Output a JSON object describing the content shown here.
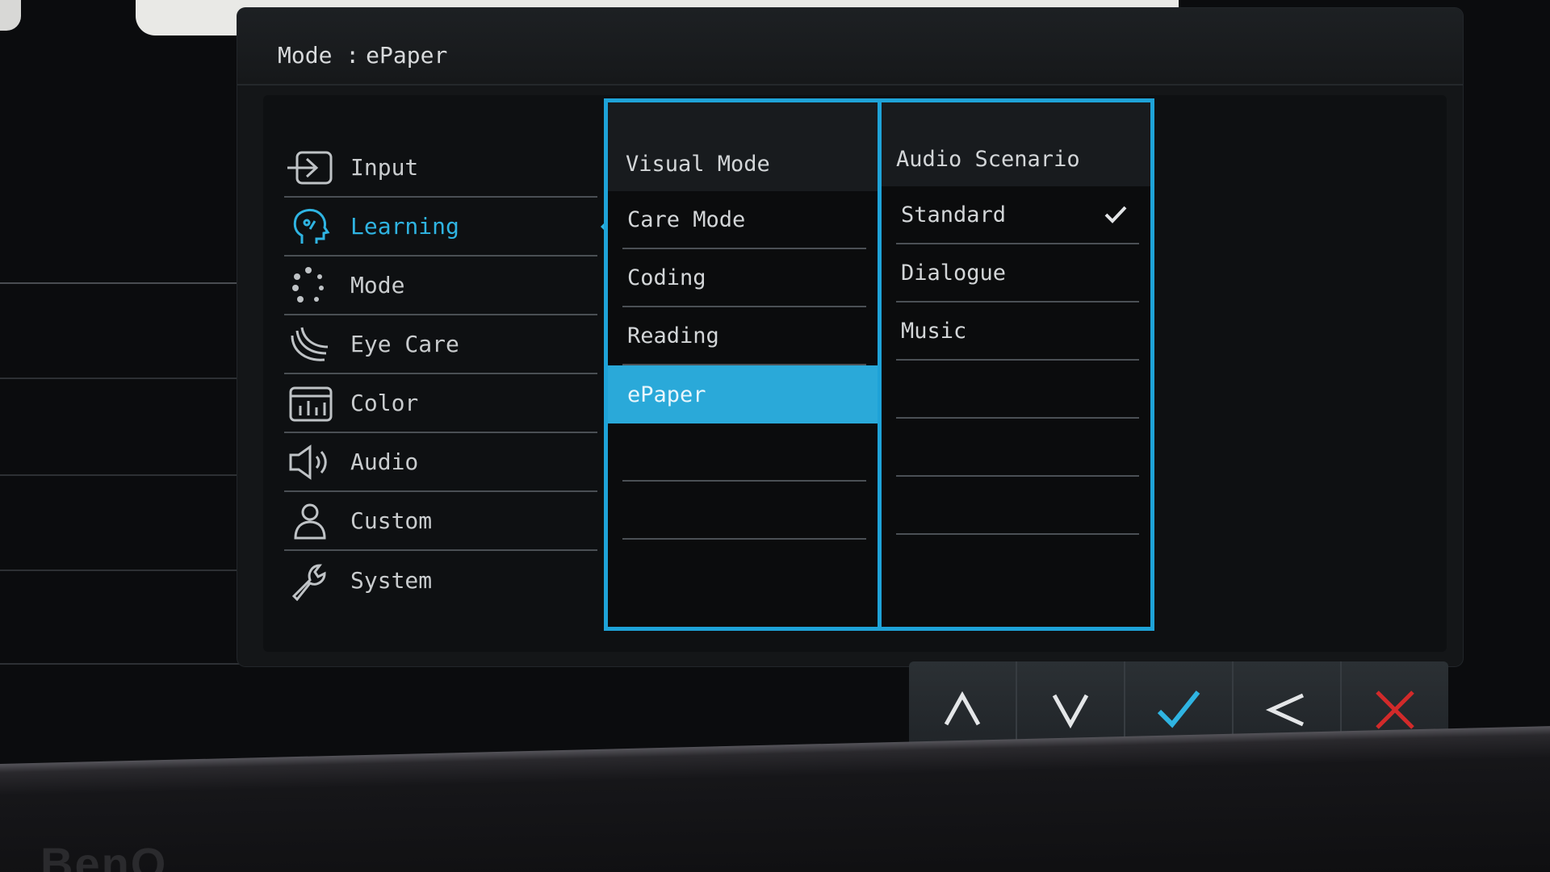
{
  "header": {
    "mode_label": "Mode :",
    "mode_value": "ePaper"
  },
  "main_menu": {
    "items": [
      {
        "label": "Input",
        "icon": "input-icon",
        "active": false
      },
      {
        "label": "Learning",
        "icon": "learning-icon",
        "active": true
      },
      {
        "label": "Mode",
        "icon": "mode-icon",
        "active": false
      },
      {
        "label": "Eye Care",
        "icon": "eye-care-icon",
        "active": false
      },
      {
        "label": "Color",
        "icon": "color-icon",
        "active": false
      },
      {
        "label": "Audio",
        "icon": "audio-icon",
        "active": false
      },
      {
        "label": "Custom",
        "icon": "custom-icon",
        "active": false
      },
      {
        "label": "System",
        "icon": "system-icon",
        "active": false
      }
    ]
  },
  "visual_mode": {
    "title": "Visual Mode",
    "options": [
      "Care Mode",
      "Coding",
      "Reading",
      "ePaper"
    ],
    "selected": "ePaper"
  },
  "audio_scenario": {
    "title": "Audio Scenario",
    "options": [
      "Standard",
      "Dialogue",
      "Music"
    ],
    "checked": "Standard"
  },
  "nav_buttons": [
    {
      "name": "up-button",
      "icon": "chevron-up-icon"
    },
    {
      "name": "down-button",
      "icon": "chevron-down-icon"
    },
    {
      "name": "confirm-button",
      "icon": "check-icon"
    },
    {
      "name": "back-button",
      "icon": "chevron-left-icon"
    },
    {
      "name": "exit-button",
      "icon": "close-icon"
    }
  ],
  "colors": {
    "accent": "#1ea3d8",
    "highlight": "#2aa9d9",
    "text": "#d3d6d8",
    "confirm": "#2fb4e2",
    "close": "#d22a2a"
  }
}
